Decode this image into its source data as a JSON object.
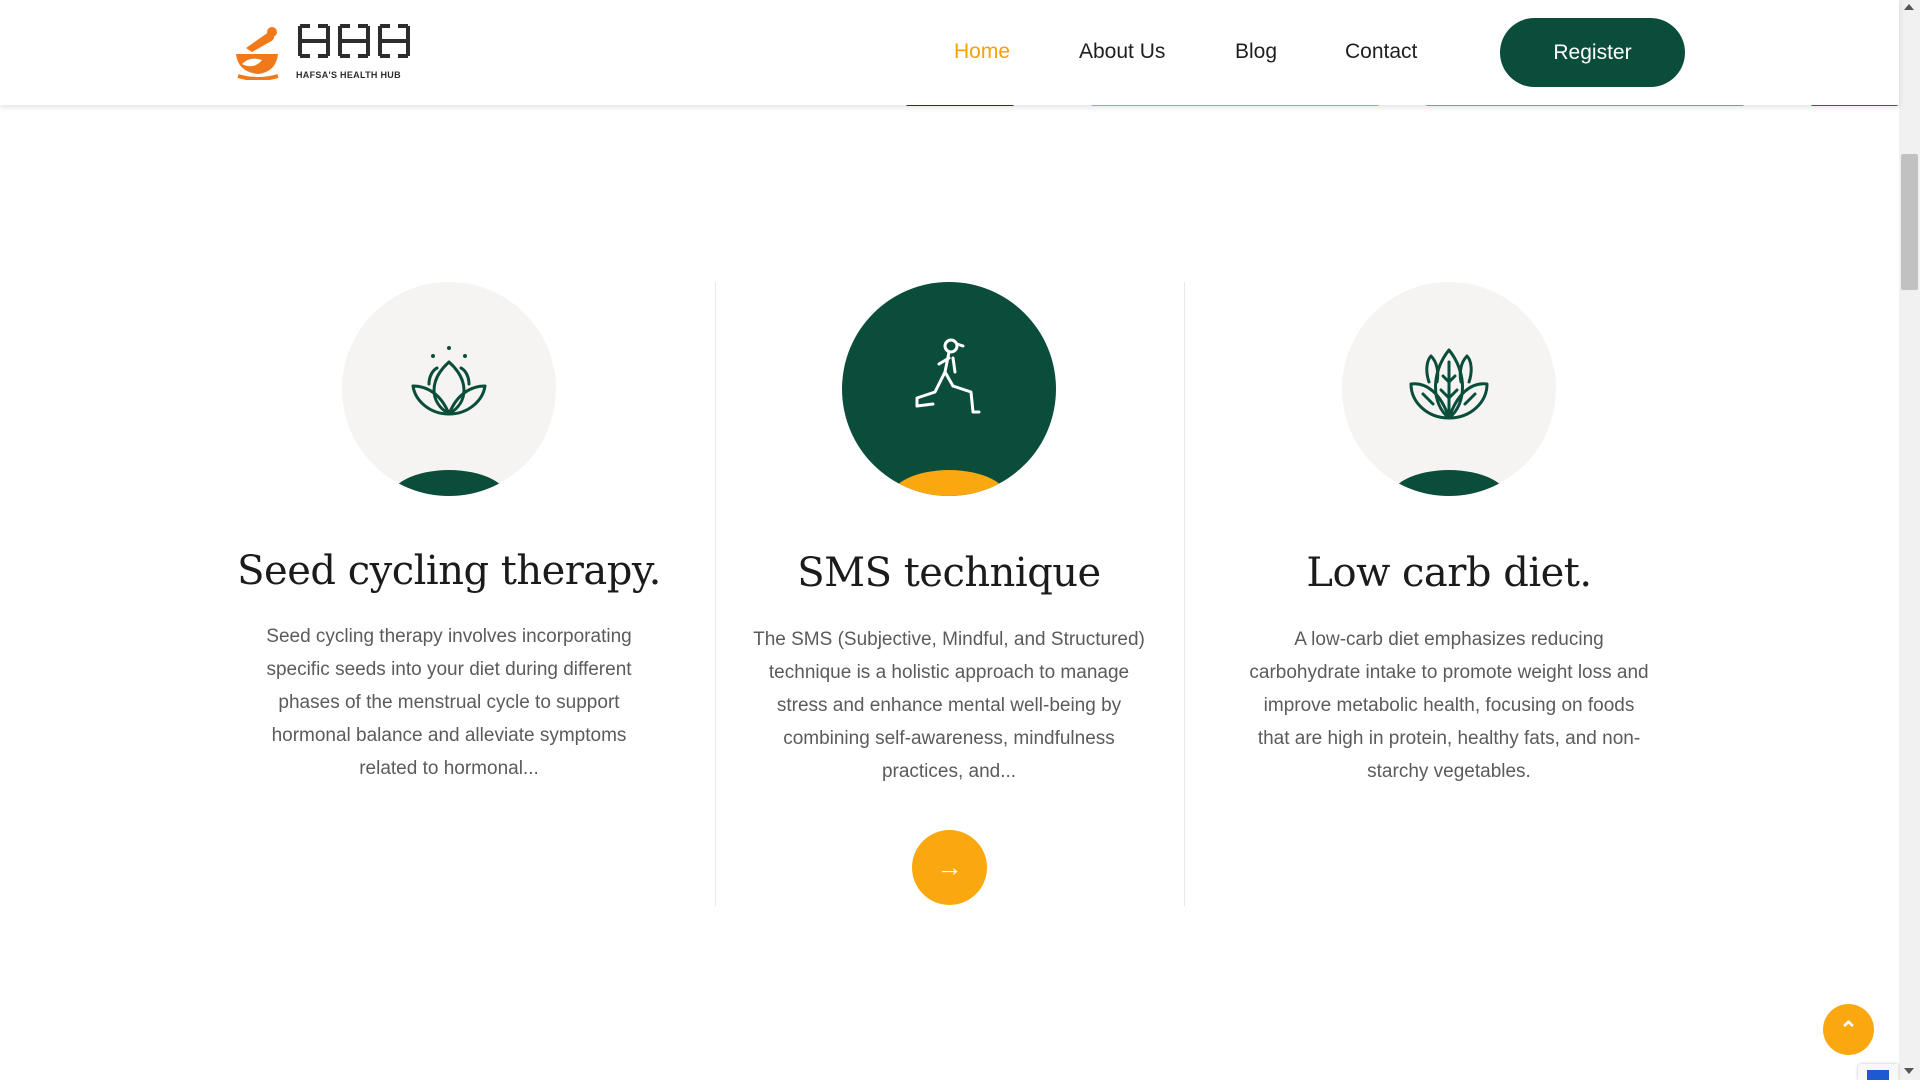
{
  "brand": {
    "letters": "HHH",
    "tagline": "HAFSA'S HEALTH HUB",
    "colors": {
      "green": "#0b4d3b",
      "orange": "#fba70f",
      "logo_orange": "#f07a1a"
    }
  },
  "nav": {
    "items": [
      {
        "label": "Home",
        "active": true
      },
      {
        "label": "About Us",
        "active": false
      },
      {
        "label": "Blog",
        "active": false
      },
      {
        "label": "Contact",
        "active": false
      }
    ],
    "register_label": "Register"
  },
  "services": [
    {
      "icon": "lotus-icon",
      "title": "Seed cycling therapy.",
      "description": "Seed cycling therapy involves incorporating specific seeds into your diet during different phases of the menstrual cycle to support hormonal balance and alleviate symptoms related to hormonal..."
    },
    {
      "icon": "lunge-exercise-icon",
      "title": "SMS technique",
      "description": "The SMS (Subjective, Mindful, and Structured) technique is a holistic approach to manage stress and enhance mental well-being by combining self-awareness, mindfulness practices, and..."
    },
    {
      "icon": "leaf-lotus-icon",
      "title": "Low carb diet.",
      "description": "A low-carb diet emphasizes reducing carbohydrate intake to promote weight loss and improve metabolic health, focusing on foods that are high in protein, healthy fats, and non-starchy vegetables."
    }
  ],
  "buttons": {
    "read_more_icon": "arrow-right-icon",
    "read_more_glyph": "→",
    "back_to_top_icon": "chevron-up-icon",
    "back_to_top_glyph": "⌃"
  }
}
